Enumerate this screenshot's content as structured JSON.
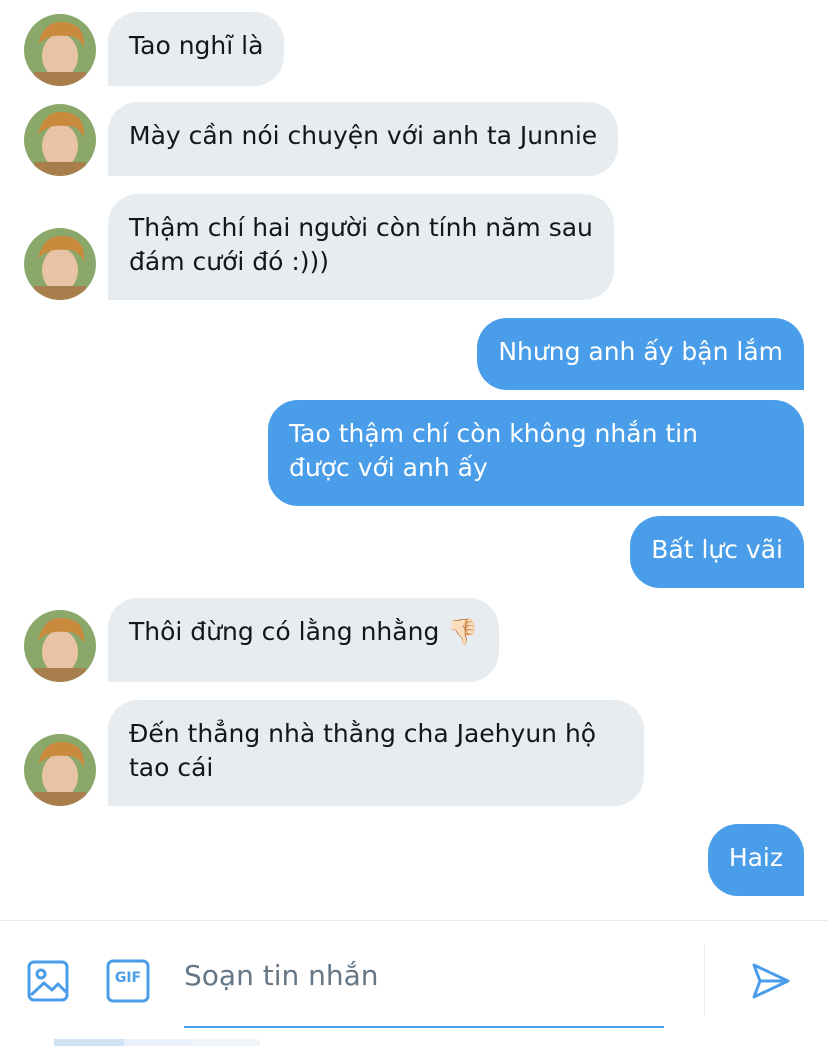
{
  "messages": [
    {
      "side": "in",
      "text": "Tao nghĩ là"
    },
    {
      "side": "in",
      "text": "Mày cần nói chuyện với anh ta Junnie"
    },
    {
      "side": "in",
      "text": "Thậm chí hai người còn tính năm sau\nđám cưới đó :)))"
    },
    {
      "side": "out",
      "text": "Nhưng anh ấy bận lắm"
    },
    {
      "side": "out",
      "text": "Tao thậm chí còn không nhắn tin\nđược với anh ấy"
    },
    {
      "side": "out",
      "text": "Bất lực vãi"
    },
    {
      "side": "in",
      "text": "Thôi đừng có lằng nhằng 👎🏻"
    },
    {
      "side": "in",
      "text": "Đến thẳng nhà thằng cha Jaehyun hộ\ntao cái"
    },
    {
      "side": "out",
      "text": "Haiz"
    }
  ],
  "composer": {
    "placeholder": "Soạn tin nhắn",
    "gif_label": "GIF",
    "icons": [
      "image-icon",
      "gif-icon",
      "send-icon"
    ]
  },
  "colors": {
    "incoming_bubble": "#e6ecf0",
    "outgoing_bubble": "#4a9de9",
    "accent": "#4a9de9"
  }
}
